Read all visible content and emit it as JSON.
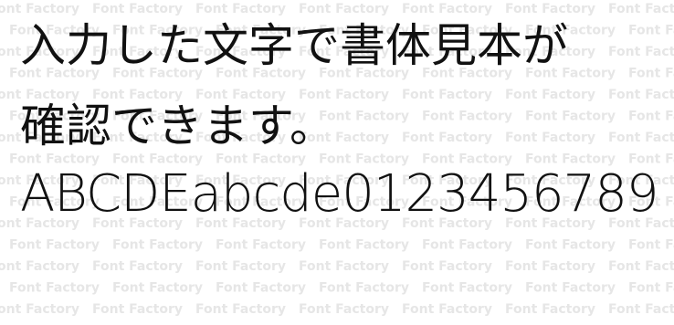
{
  "sample": {
    "line1": "入力した文字で書体見本が",
    "line2": "確認できます。",
    "line3": "ABCDEabcde0123456789"
  },
  "watermark": {
    "text": "Font Factory",
    "color": "#e6e6e6"
  }
}
